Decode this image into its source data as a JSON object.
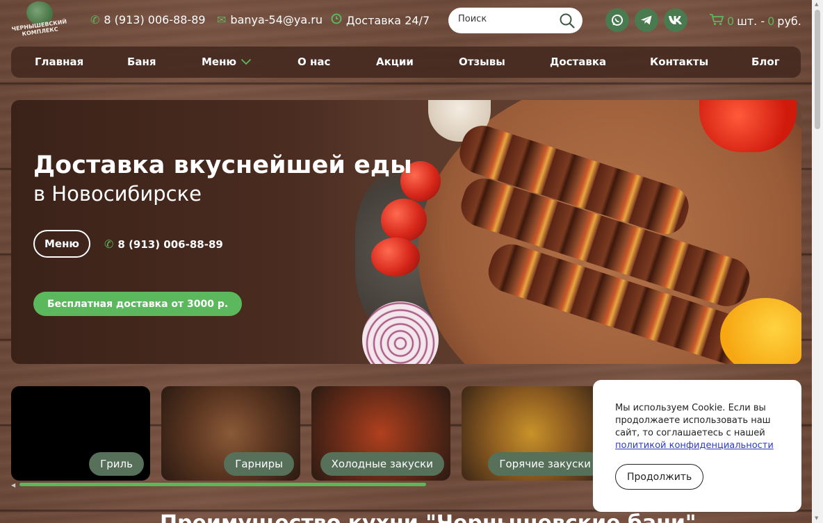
{
  "header": {
    "logo_text": "ЧЕРНЫШЕВСКИЙ КОМПЛЕКС",
    "phone": "8 (913) 006-88-89",
    "email": "banya-54@ya.ru",
    "delivery": "Доставка 24/7",
    "search_placeholder": "Поиск",
    "cart": {
      "count": "0",
      "count_unit": "шт. -",
      "sum": "0",
      "currency": "руб."
    },
    "social_icons": [
      "whatsapp-icon",
      "telegram-icon",
      "vk-icon"
    ]
  },
  "nav": {
    "items": [
      "Главная",
      "Баня",
      "Меню",
      "О нас",
      "Акции",
      "Отзывы",
      "Доставка",
      "Контакты",
      "Блог"
    ]
  },
  "hero": {
    "title": "Доставка вкуснейшей еды",
    "subtitle": "в Новосибирске",
    "menu_button": "Меню",
    "phone": "8 (913) 006-88-89",
    "free_delivery_button": "Бесплатная доставка от 3000 р."
  },
  "categories": [
    "Гриль",
    "Гарниры",
    "Холодные закуски",
    "Горячие закуски"
  ],
  "section_title": "Преимущество кухни \"Чернышевские бани\"",
  "cookie": {
    "text": "Мы используем Cookie. Если вы продолжаете использовать наш сайт, то соглашаетесь с нашей",
    "link": "политикой конфиденциальности",
    "button": "Продолжить"
  },
  "colors": {
    "accent_green": "#5cb85c",
    "social_green": "#4a7a4f",
    "nav_bg": "#46281f",
    "category_label": "#56705a",
    "link_blue": "#2a3bc4"
  }
}
